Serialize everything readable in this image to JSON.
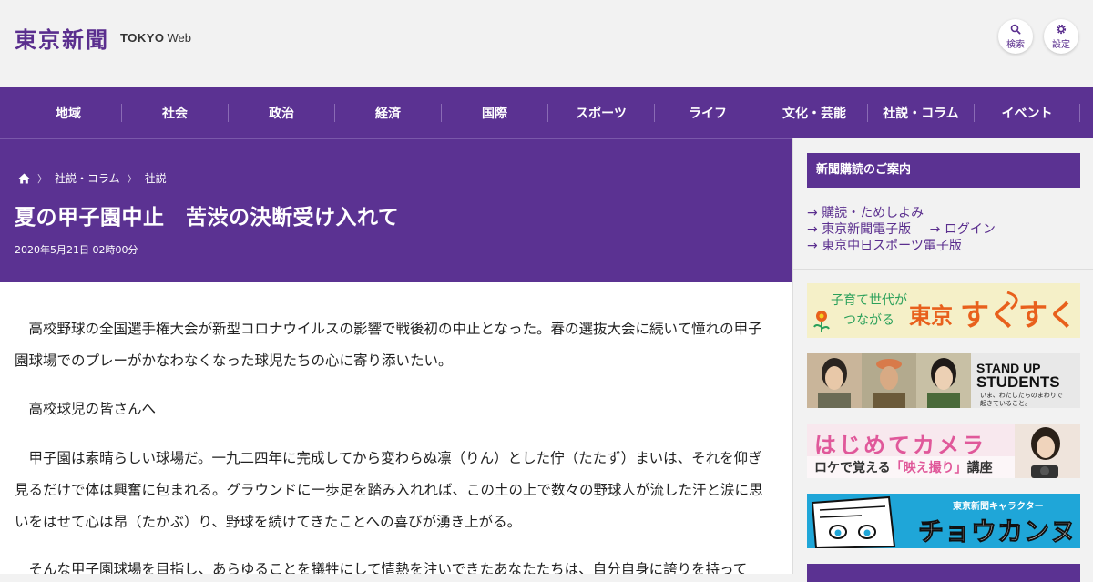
{
  "header": {
    "logo_kanji": "東京新聞",
    "logo_tokyo": "TOKYO",
    "logo_web": "Web",
    "search_label": "検索",
    "settings_label": "設定"
  },
  "nav": {
    "items": [
      "地域",
      "社会",
      "政治",
      "経済",
      "国際",
      "スポーツ",
      "ライフ",
      "文化・芸能",
      "社説・コラム",
      "イベント"
    ]
  },
  "breadcrumb": {
    "items": [
      "社説・コラム",
      "社説"
    ]
  },
  "article": {
    "title": "夏の甲子園中止　苦渋の決断受け入れて",
    "date": "2020年5月21日 02時00分",
    "paragraphs": [
      "高校野球の全国選手権大会が新型コロナウイルスの影響で戦後初の中止となった。春の選抜大会に続いて憧れの甲子園球場でのプレーがかなわなくなった球児たちの心に寄り添いたい。",
      "高校球児の皆さんへ",
      "甲子園は素晴らしい球場だ。一九二四年に完成してから変わらぬ凛（りん）とした佇（たたず）まいは、それを仰ぎ見るだけで体は興奮に包まれる。グラウンドに一歩足を踏み入れれば、この土の上で数々の野球人が流した汗と涙に思いをはせて心は昂（たかぶ）り、野球を続けてきたことへの喜びが湧き上がる。",
      "そんな甲子園球場を目指し、あらゆることを犠牲にして情熱を注いできたあなたたちは、自分自身に誇りを持って"
    ]
  },
  "sidebar": {
    "heading": "新聞購読のご案内",
    "links": {
      "subscribe": "購読・ためしよみ",
      "e_paper": "東京新聞電子版",
      "login": "ログイン",
      "sports": "東京中日スポーツ電子版"
    },
    "banners": {
      "sukusuku_line1": "子育て世代が",
      "sukusuku_line2": "つながる",
      "sukusuku_tokyo": "東京",
      "sukusuku_brand": "すくすく",
      "standup_line1": "STAND UP",
      "standup_line2": "STUDENTS",
      "standup_caption1": "いま、わたしたちのまわりで",
      "standup_caption2": "起きていること。",
      "camera_title": "はじめてカメラ",
      "camera_sub_pre": "ロケで覚える",
      "camera_sub_mid": "「映え撮り」",
      "camera_sub_post": "講座",
      "chokanzu_sub": "東京新聞キャラクター",
      "chokanzu_title": "チョウカンヌ"
    },
    "colors": {
      "sukusuku_orange": "#e8601c",
      "sukusuku_green": "#2aa05a",
      "camera_pink": "#e0589a",
      "chokanzu_blue": "#1fa6d8"
    }
  },
  "colors": {
    "brand_purple": "#5b3292",
    "logo_purple": "#5a2e8e"
  },
  "icons": {
    "search": "search-icon",
    "settings": "gear-icon",
    "home": "home-icon",
    "arrow": "arrow-right-icon"
  }
}
